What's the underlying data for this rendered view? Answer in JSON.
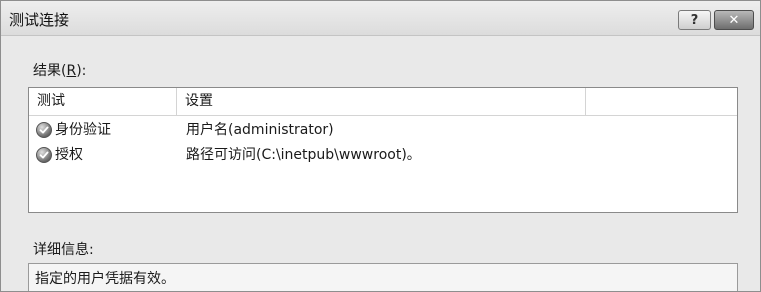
{
  "window": {
    "title": "测试连接",
    "help_glyph": "?",
    "close_glyph": "✕"
  },
  "results": {
    "label_prefix": "结果(",
    "label_mnemonic": "R",
    "label_suffix": "):",
    "columns": [
      "测试",
      "设置",
      ""
    ],
    "rows": [
      {
        "icon": "check-circle-icon",
        "test": "身份验证",
        "setting": "用户名(administrator)"
      },
      {
        "icon": "check-circle-icon",
        "test": "授权",
        "setting": "路径可访问(C:\\inetpub\\wwwroot)。"
      }
    ]
  },
  "details": {
    "label": "详细信息:",
    "text": "指定的用户凭据有效。"
  }
}
